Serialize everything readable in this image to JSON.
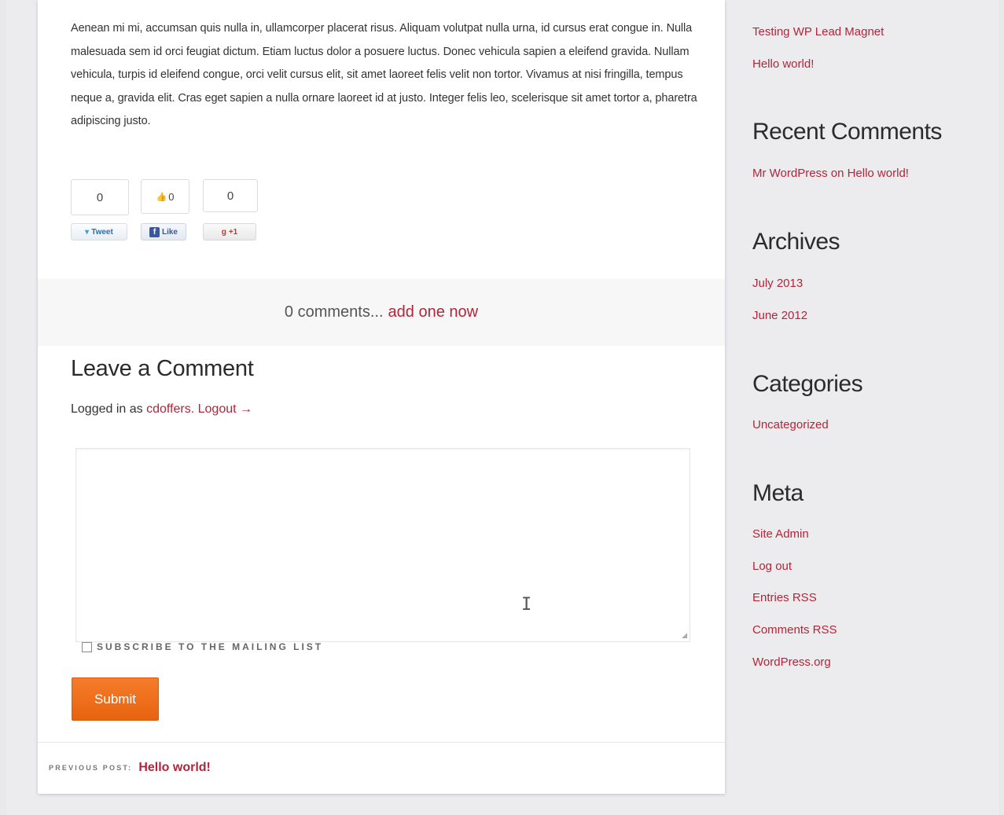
{
  "article": {
    "paragraph": "Aenean mi mi, accumsan quis nulla in, ullamcorper placerat risus. Aliquam volutpat nulla urna, id cursus erat congue in. Nulla malesuada sem id orci feugiat dictum. Etiam luctus dolor a posuere luctus. Donec vehicula sapien a eleifend gravida. Nullam vehicula, turpis id eleifend congue, orci velit cursus elit, sit amet laoreet felis velit non tortor. Vivamus at nisi fringilla, tempus neque a, gravida elit. Cras eget sapien a nulla ornare laoreet id at justo. Integer felis leo, scelerisque sit amet tortor a, pharetra adipiscing justo."
  },
  "social": {
    "tweet": {
      "count": "0",
      "label": "Tweet"
    },
    "facebook": {
      "count": "0",
      "label": "Like"
    },
    "google": {
      "count": "0",
      "label": "+1"
    }
  },
  "comments_band": {
    "count_text": "0 comments...",
    "link_text": "add one now"
  },
  "comment_form": {
    "title": "Leave a Comment",
    "logged_in_prefix": "Logged in as",
    "username": "cdoffers.",
    "logout": "Logout →",
    "textarea_value": "",
    "subscribe_label": "SUBSCRIBE TO THE MAILING LIST",
    "subscribe_checked": false,
    "submit_label": "Submit"
  },
  "post_nav": {
    "label": "PREVIOUS POST:",
    "link": "Hello world!"
  },
  "sidebar": {
    "recent_posts": [
      "Testing WP Lead Magnet",
      "Hello world!"
    ],
    "recent_comments_title": "Recent Comments",
    "recent_comments": [
      "Mr WordPress on Hello world!"
    ],
    "archives_title": "Archives",
    "archives": [
      "July 2013",
      "June 2012"
    ],
    "categories_title": "Categories",
    "categories": [
      "Uncategorized"
    ],
    "meta_title": "Meta",
    "meta": [
      "Site Admin",
      "Log out",
      "Entries RSS",
      "Comments RSS",
      "WordPress.org"
    ]
  },
  "colors": {
    "link": "#b0263a",
    "submit": "#e8620f",
    "background": "#e9e8ea"
  }
}
